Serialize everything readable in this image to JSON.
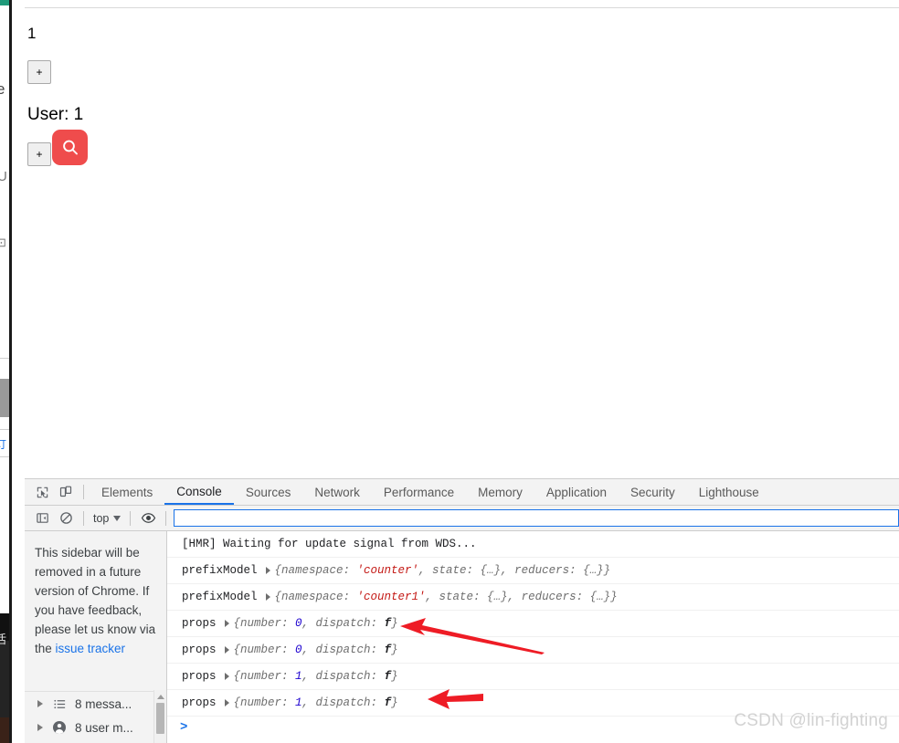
{
  "page": {
    "counter_value": "1",
    "increment_label": "+",
    "user_label": "User: 1",
    "user_increment_label": "+",
    "search_badge_icon": "search-icon"
  },
  "devtools": {
    "inspect_icon": "inspect-element-icon",
    "device_icon": "device-toolbar-icon",
    "tabs": [
      {
        "label": "Elements",
        "active": false
      },
      {
        "label": "Console",
        "active": true
      },
      {
        "label": "Sources",
        "active": false
      },
      {
        "label": "Network",
        "active": false
      },
      {
        "label": "Performance",
        "active": false
      },
      {
        "label": "Memory",
        "active": false
      },
      {
        "label": "Application",
        "active": false
      },
      {
        "label": "Security",
        "active": false
      },
      {
        "label": "Lighthouse",
        "active": false
      }
    ],
    "toolbar": {
      "sidebar_toggle_icon": "sidebar-toggle-icon",
      "clear_console_icon": "clear-console-icon",
      "context_selected": "top",
      "eye_icon": "live-expression-eye-icon",
      "filter_value": "",
      "filter_placeholder": ""
    },
    "sidebar": {
      "notice": "This sidebar will be removed in a future version of Chrome. If you have feedback, please let us know via the ",
      "notice_link": "issue tracker",
      "tree": [
        {
          "icon": "list-icon",
          "label": "8 messa..."
        },
        {
          "icon": "user-icon",
          "label": "8 user m..."
        }
      ]
    },
    "console": {
      "messages": [
        {
          "label": "[HMR] Waiting for update signal from WDS...",
          "type": "plain"
        },
        {
          "label": "prefixModel",
          "type": "object",
          "preview_open": "{namespace: ",
          "preview_string": "'counter'",
          "preview_rest": ", state: {…}, reducers: {…}}"
        },
        {
          "label": "prefixModel",
          "type": "object",
          "preview_open": "{namespace: ",
          "preview_string": "'counter1'",
          "preview_rest": ", state: {…}, reducers: {…}}"
        },
        {
          "label": "props",
          "type": "props",
          "preview_open": "{number: ",
          "preview_number": "0",
          "preview_mid": ", dispatch: ",
          "preview_fn": "f",
          "preview_close": "}"
        },
        {
          "label": "props",
          "type": "props",
          "preview_open": "{number: ",
          "preview_number": "0",
          "preview_mid": ", dispatch: ",
          "preview_fn": "f",
          "preview_close": "}"
        },
        {
          "label": "props",
          "type": "props",
          "preview_open": "{number: ",
          "preview_number": "1",
          "preview_mid": ", dispatch: ",
          "preview_fn": "f",
          "preview_close": "}"
        },
        {
          "label": "props",
          "type": "props",
          "preview_open": "{number: ",
          "preview_number": "1",
          "preview_mid": ", dispatch: ",
          "preview_fn": "f",
          "preview_close": "}"
        }
      ],
      "prompt": ">"
    }
  },
  "annotations": {
    "arrow_color": "#ee1c25",
    "arrow_count": 2
  },
  "watermark": "CSDN @lin-fighting",
  "background_fragments": {
    "frag_e": "e",
    "frag_u": "U",
    "frag_box": "⊡",
    "frag_blue": "订",
    "frag_cjk": "活"
  },
  "colors": {
    "accent_blue": "#1a73e8",
    "badge_red": "#ef4c4c",
    "annotation_red": "#ee1c25",
    "string_red": "#c41a16",
    "number_blue": "#1c00cf"
  }
}
